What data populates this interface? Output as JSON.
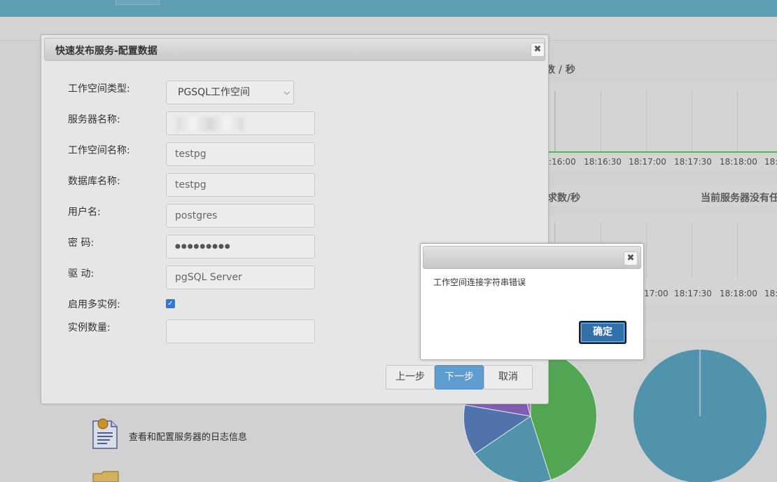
{
  "background": {
    "chart1": {
      "title": "数 / 秒",
      "ticks": [
        ":16:00",
        "18:16:30",
        "18:17:00",
        "18:17:30",
        "18:18:00",
        "18:"
      ]
    },
    "chart2": {
      "title": "求数/秒",
      "ticks": [
        "17:00",
        "18:17:30",
        "18:18:00",
        "18:"
      ]
    },
    "chart3": {
      "title": "当前服务器没有任"
    },
    "log_link": "查看和配置服务器的日志信息",
    "pie_colors": [
      "#5cb85c",
      "#5ba4c0",
      "#5b80c0",
      "#8f68c9",
      "#c07fd4"
    ]
  },
  "dialog": {
    "title": "快速发布服务-配置数据",
    "close_glyph": "✖",
    "labels": {
      "workspace_type": "工作空间类型:",
      "server_name": "服务器名称:",
      "workspace_name": "工作空间名称:",
      "database_name": "数据库名称:",
      "username": "用户名:",
      "password": "密 码:",
      "driver": "驱 动:",
      "multi_instance": "启用多实例:",
      "instance_count": "实例数量:"
    },
    "values": {
      "workspace_type": "PGSQL工作空间",
      "server_name": "",
      "workspace_name": "testpg",
      "database_name": "testpg",
      "username": "postgres",
      "password": "●●●●●●●●●",
      "driver": "pgSQL Server",
      "instance_count": ""
    },
    "multi_instance_checked": true,
    "buttons": {
      "prev": "上一步",
      "next": "下一步",
      "cancel": "取消"
    }
  },
  "alert": {
    "close_glyph": "✖",
    "message": "工作空间连接字符串错误",
    "ok": "确定"
  }
}
